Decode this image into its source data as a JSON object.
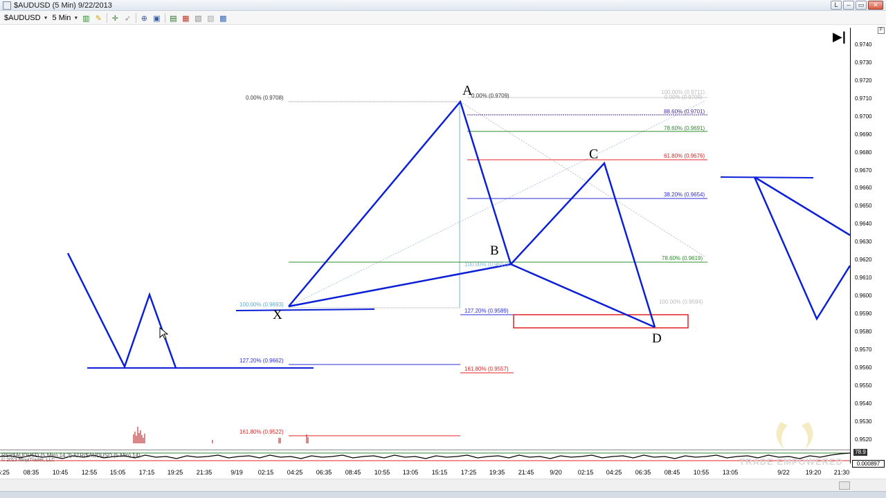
{
  "window": {
    "title": "$AUDUSD (5 Min)  9/22/2013",
    "buttons": [
      "L",
      "–",
      "▭",
      "✕"
    ]
  },
  "toolbar": {
    "instrument": "$AUDUSD",
    "interval": "5 Min",
    "icons": [
      "bar-chart-icon",
      "pencil-icon",
      "crosshair-icon",
      "cursor-icon",
      "zoom-icon",
      "magnify-icon",
      "properties-icon",
      "strategy-icon",
      "data-box-icon",
      "close-chart-icon",
      "chart-trader-icon"
    ]
  },
  "price_axis": {
    "labels": [
      "0.9740",
      "0.9730",
      "0.9720",
      "0.9710",
      "0.9700",
      "0.9690",
      "0.9680",
      "0.9670",
      "0.9660",
      "0.9650",
      "0.9640",
      "0.9630",
      "0.9620",
      "0.9610",
      "0.9600",
      "0.9590",
      "0.9580",
      "0.9570",
      "0.9560",
      "0.9550",
      "0.9540",
      "0.9530",
      "0.9520"
    ]
  },
  "time_axis": {
    "labels": [
      "6:25",
      "08:35",
      "10:45",
      "12:55",
      "15:05",
      "17:15",
      "19:25",
      "21:35",
      "9/19",
      "02:15",
      "04:25",
      "06:35",
      "08:45",
      "10:55",
      "13:05",
      "15:15",
      "17:25",
      "19:35",
      "21:45",
      "9/20",
      "02:15",
      "04:25",
      "06:35",
      "08:45",
      "10:55",
      "13:05",
      "9/22",
      "19:20",
      "21:30"
    ]
  },
  "pattern_points": {
    "X": "X",
    "A": "A",
    "B": "B",
    "C": "C",
    "D": "D"
  },
  "fib_labels": {
    "xa_top": "0.00% (0.9708)",
    "xa_base": "100.00% (0.9693)",
    "xa_127": "127.20% (0.9662)",
    "xa_161": "161.80% (0.9522)",
    "ab_top": "0.00% (0.9709)",
    "ab_100": "100.00% (0.9617)",
    "ab_127": "127.20% (0.9589)",
    "ab_161": "161.80% (0.9557)",
    "r_100_top": "100.00% (0.9711)",
    "r_100_top2": "0.00% (0.9709)",
    "r_886": "88.60% (0.9701)",
    "r_786": "78.60% (0.9691)",
    "r_618": "61.80% (0.9676)",
    "r_382": "38.20% (0.9654)",
    "r_786_low": "78.60% (0.9619)",
    "r_100_low": "100.00% (0.9594)"
  },
  "indicator": {
    "label": "RSI($AUDUSD (5 Min),14,3)  ATR($AUDUSD (5 Min),14)",
    "copyright": "© 2013 NinjaTrader, LLC",
    "value_a": "78.9",
    "value_b": "0.000897"
  },
  "watermark": "TRADE EMPOWERED",
  "colors": {
    "pattern": "#0b1fd6",
    "fib_green": "#2e8b2e",
    "fib_red": "#e02020",
    "fib_blue": "#2b2bd9",
    "fib_purple": "#4b2b9e",
    "fib_gray": "#bbbbbb",
    "prz_box": "#e02020"
  }
}
